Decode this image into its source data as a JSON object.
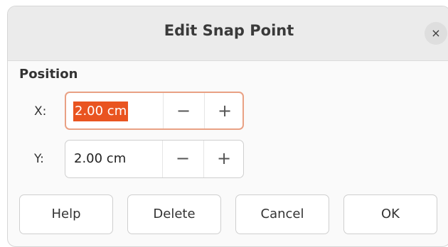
{
  "dialog": {
    "title": "Edit Snap Point",
    "close_label": "×"
  },
  "position": {
    "section_label": "Position",
    "x": {
      "label": "X:",
      "value": "2.00 cm",
      "minus": "−",
      "plus": "+"
    },
    "y": {
      "label": "Y:",
      "value": "2.00 cm",
      "minus": "−",
      "plus": "+"
    }
  },
  "buttons": {
    "help": "Help",
    "delete": "Delete",
    "cancel": "Cancel",
    "ok": "OK"
  },
  "colors": {
    "accent": "#e95420",
    "focus_ring": "#e9a184"
  }
}
